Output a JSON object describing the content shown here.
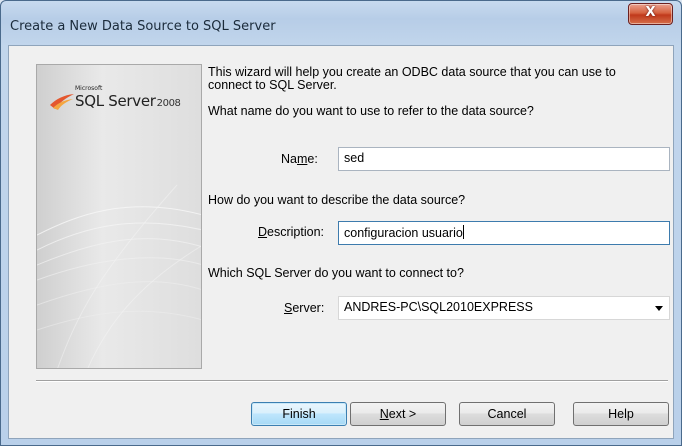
{
  "window": {
    "title": "Create a New Data Source to SQL Server",
    "close_glyph": "X"
  },
  "banner": {
    "logo_microsoft": "Microsoft",
    "logo_product": "SQL Server",
    "logo_year": "2008"
  },
  "intro": {
    "line1": "This wizard will help you create an ODBC data source that you can use to",
    "line2": "connect to SQL Server."
  },
  "name_section": {
    "question": "What name do you want to use to refer to the data source?",
    "label_pre": "Na",
    "label_accel": "m",
    "label_post": "e:",
    "value": "sed"
  },
  "description_section": {
    "question": "How do you want to describe the data source?",
    "label_accel": "D",
    "label_post": "escription:",
    "value": "configuracion usuario"
  },
  "server_section": {
    "question": "Which SQL Server do you want to connect to?",
    "label_accel": "S",
    "label_post": "erver:",
    "value": "ANDRES-PC\\SQL2010EXPRESS"
  },
  "buttons": {
    "finish": "Finish",
    "next_accel": "N",
    "next_post": "ext >",
    "cancel": "Cancel",
    "help": "Help"
  }
}
